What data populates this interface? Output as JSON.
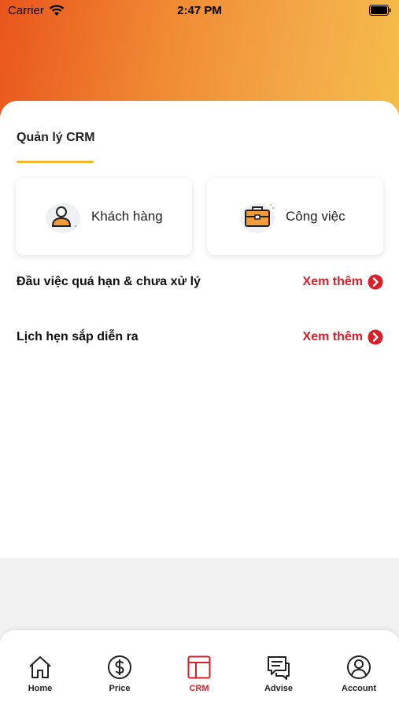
{
  "status_bar": {
    "carrier": "Carrier",
    "time": "2:47 PM"
  },
  "section": {
    "title": "Quản lý CRM"
  },
  "cards": {
    "customers": {
      "label": "Khách hàng",
      "icon": "user-icon"
    },
    "tasks": {
      "label": "Công việc",
      "icon": "briefcase-icon"
    }
  },
  "rows": {
    "overdue": {
      "title": "Đầu việc quá hạn & chưa xử lý",
      "link": "Xem thêm"
    },
    "appointments": {
      "title": "Lịch hẹn sắp diễn ra",
      "link": "Xem thêm"
    }
  },
  "tabbar": {
    "active": "CRM",
    "items": [
      {
        "label": "Home",
        "icon": "home-icon"
      },
      {
        "label": "Price",
        "icon": "dollar-icon"
      },
      {
        "label": "CRM",
        "icon": "crm-icon"
      },
      {
        "label": "Advise",
        "icon": "chat-icon"
      },
      {
        "label": "Account",
        "icon": "account-icon"
      }
    ]
  },
  "colors": {
    "accent": "#d81f2a",
    "underline": "#f2b630",
    "gradient_start": "#e9551c",
    "gradient_end": "#f5bf49"
  }
}
